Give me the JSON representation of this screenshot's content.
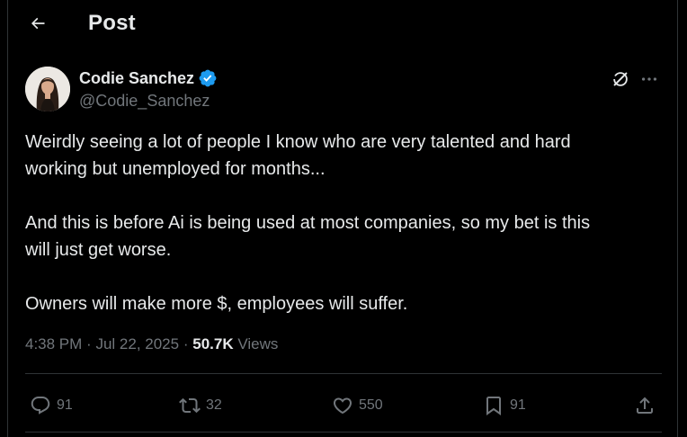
{
  "header": {
    "title": "Post",
    "back_icon": "arrow-left-icon"
  },
  "author": {
    "name": "Codie Sanchez",
    "handle": "@Codie_Sanchez",
    "verified": true,
    "verified_color": "#1d9bf0"
  },
  "post": {
    "paragraphs": [
      [
        "Weirdly seeing a lot of people I know who are very talented and hard",
        "working but unemployed for months..."
      ],
      [
        "And this is before Ai is being used at most companies, so my bet is this",
        "will just get worse."
      ],
      [
        "Owners will make more $, employees will suffer."
      ]
    ],
    "time": "4:38 PM",
    "separator": "·",
    "date": "Jul 22, 2025",
    "views_count": "50.7K",
    "views_label": "Views"
  },
  "actions": {
    "replies": "91",
    "reposts": "32",
    "likes": "550",
    "bookmarks": "91"
  },
  "colors": {
    "background": "#000000",
    "text_primary": "#e7e9ea",
    "text_secondary": "#71767b",
    "border": "#2f3336"
  }
}
